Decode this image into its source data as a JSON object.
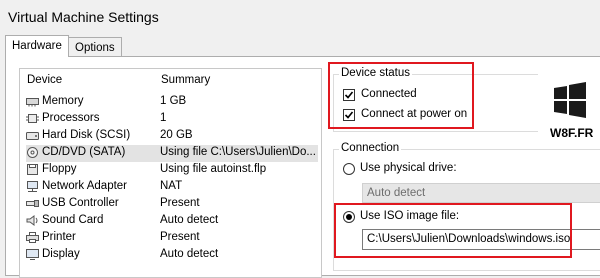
{
  "window": {
    "title": "Virtual Machine Settings"
  },
  "tabs": [
    {
      "label": "Hardware",
      "active": true
    },
    {
      "label": "Options",
      "active": false
    }
  ],
  "device_list": {
    "headers": {
      "device": "Device",
      "summary": "Summary"
    },
    "rows": [
      {
        "icon": "memory-icon",
        "name": "Memory",
        "summary": "1 GB"
      },
      {
        "icon": "processor-icon",
        "name": "Processors",
        "summary": "1"
      },
      {
        "icon": "hard-disk-icon",
        "name": "Hard Disk (SCSI)",
        "summary": "20 GB"
      },
      {
        "icon": "cd-dvd-icon",
        "name": "CD/DVD (SATA)",
        "summary": "Using file C:\\Users\\Julien\\Do...",
        "selected": true
      },
      {
        "icon": "floppy-icon",
        "name": "Floppy",
        "summary": "Using file autoinst.flp"
      },
      {
        "icon": "network-adapter-icon",
        "name": "Network Adapter",
        "summary": "NAT"
      },
      {
        "icon": "usb-controller-icon",
        "name": "USB Controller",
        "summary": "Present"
      },
      {
        "icon": "sound-card-icon",
        "name": "Sound Card",
        "summary": "Auto detect"
      },
      {
        "icon": "printer-icon",
        "name": "Printer",
        "summary": "Present"
      },
      {
        "icon": "display-icon",
        "name": "Display",
        "summary": "Auto detect"
      }
    ]
  },
  "device_status": {
    "label": "Device status",
    "connected": {
      "label": "Connected",
      "checked": true
    },
    "connect_at_power_on": {
      "label": "Connect at power on",
      "checked": true
    }
  },
  "connection": {
    "label": "Connection",
    "physical_drive": {
      "label": "Use physical drive:",
      "selected": false,
      "value": "Auto detect"
    },
    "iso_image": {
      "label": "Use ISO image file:",
      "selected": true,
      "value": "C:\\Users\\Julien\\Downloads\\windows.iso"
    }
  },
  "watermark": {
    "text": "W8F.FR"
  },
  "colors": {
    "highlight_box": "#e0181f",
    "selected_row": "#e3e3e3"
  }
}
